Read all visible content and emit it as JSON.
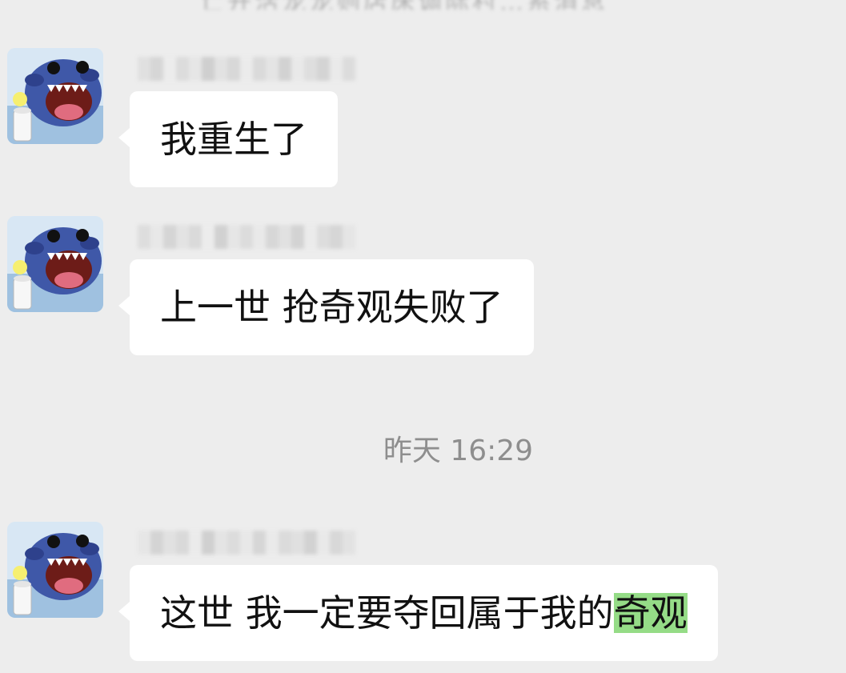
{
  "chat": {
    "top_partial_text": "亡开活龙龙则店床调际村…系消息",
    "messages": [
      {
        "sender": "",
        "text": "我重生了"
      },
      {
        "sender": "",
        "text": "上一世 抢奇观失败了"
      },
      {
        "sender": "",
        "text_before_highlight": "这世  我一定要夺回属于我的",
        "highlight": "奇观"
      }
    ],
    "timestamp": "昨天 16:29",
    "avatar_icon": "stitch-avatar",
    "highlight_color": "#95dc87",
    "background_color": "#ededed"
  }
}
